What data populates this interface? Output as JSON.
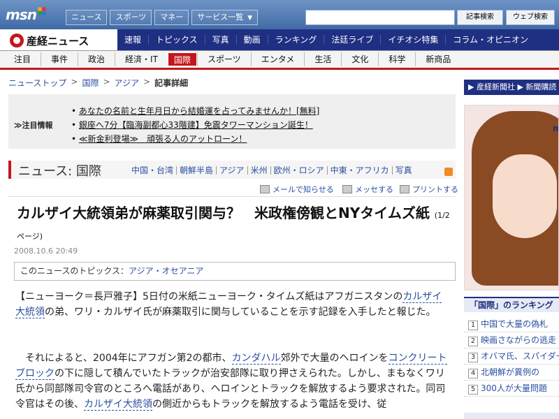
{
  "msn": {
    "logo": "msn",
    "tabs": [
      {
        "label": "ニュース"
      },
      {
        "label": "スポーツ"
      },
      {
        "label": "マネー"
      },
      {
        "label": "サービス一覧",
        "dropdown": "▼"
      }
    ],
    "search_value": "",
    "btn_article_search": "記事検索",
    "btn_web_search": "ウェブ検索"
  },
  "sankei": {
    "logo": "産経ニュース",
    "topnav": [
      "速報",
      "トピックス",
      "写真",
      "動画",
      "ランキング",
      "法廷ライブ",
      "イチオシ特集",
      "コラム・オピニオン"
    ],
    "categories": [
      "注目",
      "事件",
      "政治",
      "経済・IT",
      "国際",
      "スポーツ",
      "エンタメ",
      "生活",
      "文化",
      "科学",
      "新商品"
    ],
    "active_category": "国際"
  },
  "breadcrumb": {
    "items": [
      "ニューストップ",
      "国際",
      "アジア"
    ],
    "current": "記事詳細",
    "sep": ">"
  },
  "notice": {
    "label": "≫注目情報",
    "items": [
      "あなたの名前と生年月日から結婚運を占ってみませんか！[無料]",
      "銀座へ7分【臨海副都心33階建】免震タワーマンション誕生！",
      "≪新金利登場≫　頑張る人のアットローン！"
    ]
  },
  "section": {
    "title": "ニュース: 国際",
    "links": [
      "中国・台湾",
      "朝鮮半島",
      "アジア",
      "米州",
      "欧州・ロシア",
      "中東・アフリカ",
      "写真"
    ]
  },
  "tools": {
    "mail": "メールで知らせる",
    "messenger": "メッセする",
    "print": "プリントする"
  },
  "article": {
    "headline": "カルザイ大統領弟が麻薬取引関与？　米政権傍観とNYタイムズ紙",
    "page_note": "(1/2ページ)",
    "date": "2008.10.6 20:49",
    "topic_prefix": "このニュースのトピックス：",
    "topic_value": "アジア・オセアニア",
    "p1_a": "【ニューヨーク＝長戸雅子】5日付の米紙ニューヨーク・タイムズ紙はアフガニスタンの",
    "p1_link": "カルザイ大統領",
    "p1_b": "の弟、ワリ・カルザイ氏が麻薬取引に関与していることを示す記録を入手したと報じた。",
    "p2_a": "それによると、2004年にアフガン第2の都市、",
    "p2_link1": "カンダハル",
    "p2_b": "郊外で大量のヘロインを",
    "p2_link2": "コンクリートブロック",
    "p2_c": "の下に隠して積んでいたトラックが治安部隊に取り押さえられた。しかし、まもなくワリ氏から同部隊司令官のところへ電話があり、ヘロインとトラックを解放するよう要求された。同司令官はその後、",
    "p2_link3": "カルザイ大統領",
    "p2_d": "の側近からもトラックを解放するよう電話を受け、従"
  },
  "right": {
    "header": "▶ 産経新聞社  ▶ 新聞購読",
    "ad_logo": "ma",
    "ranking_title": "「国際」のランキング",
    "ranking": [
      {
        "n": "1",
        "text": "中国で大量の偽札"
      },
      {
        "n": "2",
        "text": "映画さながらの逃走"
      },
      {
        "n": "3",
        "text": "オバマ氏、スパイダー"
      },
      {
        "n": "4",
        "text": "北朝鮮が異例の"
      },
      {
        "n": "5",
        "text": "300人が大量問題"
      }
    ]
  }
}
